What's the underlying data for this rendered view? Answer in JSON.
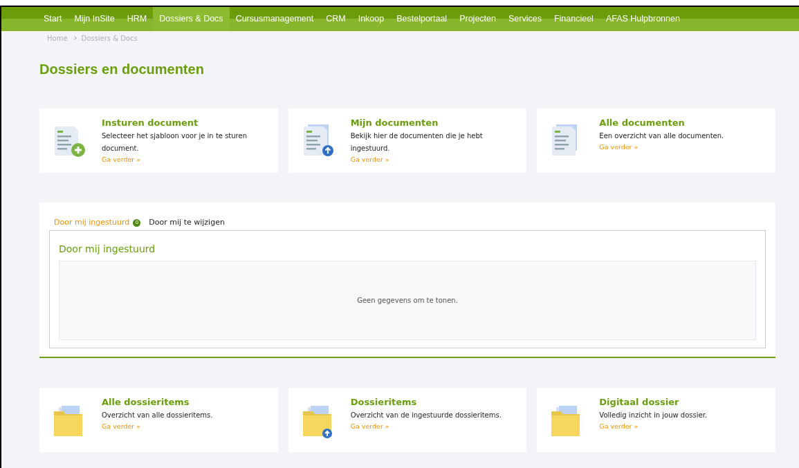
{
  "nav": [
    {
      "label": "Start",
      "selected": false
    },
    {
      "label": "Mijn InSite",
      "selected": false
    },
    {
      "label": "HRM",
      "selected": false
    },
    {
      "label": "Dossiers & Docs",
      "selected": true
    },
    {
      "label": "Cursusmanagement",
      "selected": false
    },
    {
      "label": "CRM",
      "selected": false
    },
    {
      "label": "Inkoop",
      "selected": false
    },
    {
      "label": "Bestelportaal",
      "selected": false
    },
    {
      "label": "Projecten",
      "selected": false
    },
    {
      "label": "Services",
      "selected": false
    },
    {
      "label": "Financieel",
      "selected": false
    },
    {
      "label": "AFAS Hulpbronnen",
      "selected": false
    }
  ],
  "breadcrumb": [
    "Home",
    "Dossiers & Docs"
  ],
  "title": "Dossiers en documenten",
  "top_cards": [
    {
      "kind": "doc-plus",
      "title": "Insturen document",
      "text": "Selecteer het sjabloon voor je in te sturen document.",
      "link": "Ga verder »"
    },
    {
      "kind": "doc-upload",
      "title": "Mijn documenten",
      "text": "Bekijk hier de documenten die je hebt ingestuurd.",
      "link": "Ga verder »"
    },
    {
      "kind": "doc-stack",
      "title": "Alle documenten",
      "text": "Een overzicht van alle documenten.",
      "link": "Ga verder »"
    }
  ],
  "tabs": [
    {
      "label": "Door mij ingestuurd",
      "badge": "0",
      "selected": true
    },
    {
      "label": "Door mij te wijzigen",
      "selected": false
    }
  ],
  "panel": {
    "title": "Door mij ingestuurd",
    "empty_text": "Geen gegevens om te tonen."
  },
  "bottom_cards": [
    {
      "kind": "folder",
      "title": "Alle dossieritems",
      "text": "Overzicht van alle dossieritems.",
      "link": "Ga verder »"
    },
    {
      "kind": "folder-upload",
      "title": "Dossieritems",
      "text": "Overzicht van de ingestuurde dossieritems.",
      "link": "Ga verder »"
    },
    {
      "kind": "folder",
      "title": "Digitaal dossier",
      "text": "Volledig inzicht in jouw dossier.",
      "link": "Ga verder »"
    }
  ]
}
